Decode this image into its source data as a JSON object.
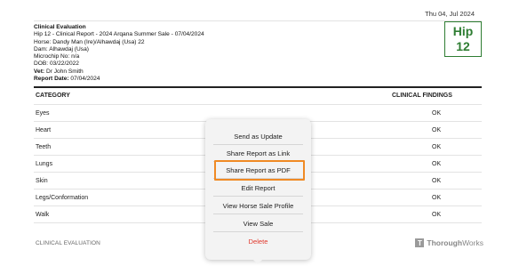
{
  "header": {
    "date": "Thu 04, Jul 2024",
    "title": "Clinical Evaluation",
    "report_line": "Hip 12 - Clinical Report - 2024 Arqana Summer Sale - 07/04/2024",
    "horse_line": "Horse: Dandy Man (Ire)/Alhawdaj (Usa) 22",
    "dam_line": "Dam: Alhawdaj (Usa)",
    "microchip_line": "Microchip No: n/a",
    "dob_line": "DOB: 03/22/2022",
    "vet_label": "Vet:",
    "vet_value": "Dr John Smith",
    "report_date_label": "Report Date:",
    "report_date_value": "07/04/2024",
    "hip_label": "Hip",
    "hip_number": "12",
    "hip_color": "#2e7d32"
  },
  "table": {
    "col_category": "CATEGORY",
    "col_findings": "CLINICAL FINDINGS",
    "rows": [
      {
        "category": "Eyes",
        "finding": "OK"
      },
      {
        "category": "Heart",
        "finding": "OK"
      },
      {
        "category": "Teeth",
        "finding": "OK"
      },
      {
        "category": "Lungs",
        "finding": "OK"
      },
      {
        "category": "Skin",
        "finding": "OK"
      },
      {
        "category": "Legs/Conformation",
        "finding": "OK"
      },
      {
        "category": "Walk",
        "finding": "OK"
      }
    ]
  },
  "footer": {
    "left": "CLINICAL EVALUATION",
    "logo_letter": "T",
    "brand_bold": "Thorough",
    "brand_rest": "Works"
  },
  "menu": {
    "items": [
      "Send as Update",
      "Share Report as Link",
      "Share Report as PDF",
      "Edit Report",
      "View Horse Sale Profile",
      "View Sale",
      "Delete"
    ],
    "highlight_color": "#f08a24",
    "delete_color": "#e03a2e"
  }
}
